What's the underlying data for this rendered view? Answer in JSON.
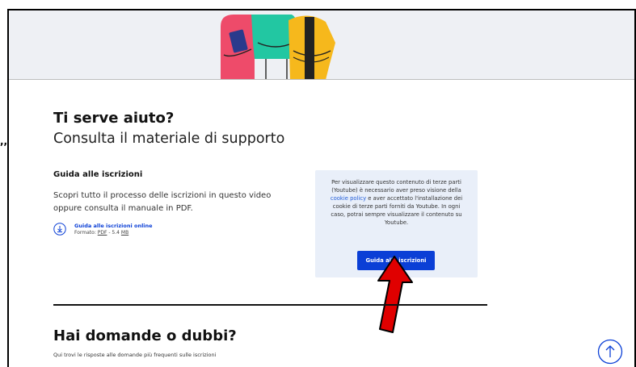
{
  "colors": {
    "accent": "#0b3fd6",
    "cookie_bg": "#e9eff9",
    "hero_bg": "#eef0f4",
    "annotation_arrow": "#e00000"
  },
  "stray_mark": ",,",
  "help": {
    "title": "Ti serve aiuto?",
    "subtitle": "Consulta il materiale di supporto"
  },
  "guide": {
    "title": "Guida alle iscrizioni",
    "description": "Scopri tutto il processo delle iscrizioni in questo video oppure consulta il manuale in PDF.",
    "download": {
      "icon": "download-icon",
      "link_label": "Guida alle iscrizioni online",
      "format_prefix": "Formato: ",
      "format": "PDF",
      "size_sep": " - 5.4 ",
      "size_unit": "MB"
    }
  },
  "cookie_notice": {
    "text_before": "Per visualizzare questo contenuto di terze parti (Youtube) è necessario aver preso visione della ",
    "link_label": "cookie policy",
    "text_after": " e aver accettato l'installazione dei cookie di terze parti forniti da Youtube. In ogni caso, potrai sempre visualizzare il contenuto su Youtube.",
    "button_label": "Guida alle iscrizioni"
  },
  "faq": {
    "title": "Hai domande o dubbi?",
    "description": "Qui trovi le risposte alle domande più frequenti sulle iscrizioni"
  },
  "scroll_up": {
    "icon": "arrow-up-icon"
  }
}
